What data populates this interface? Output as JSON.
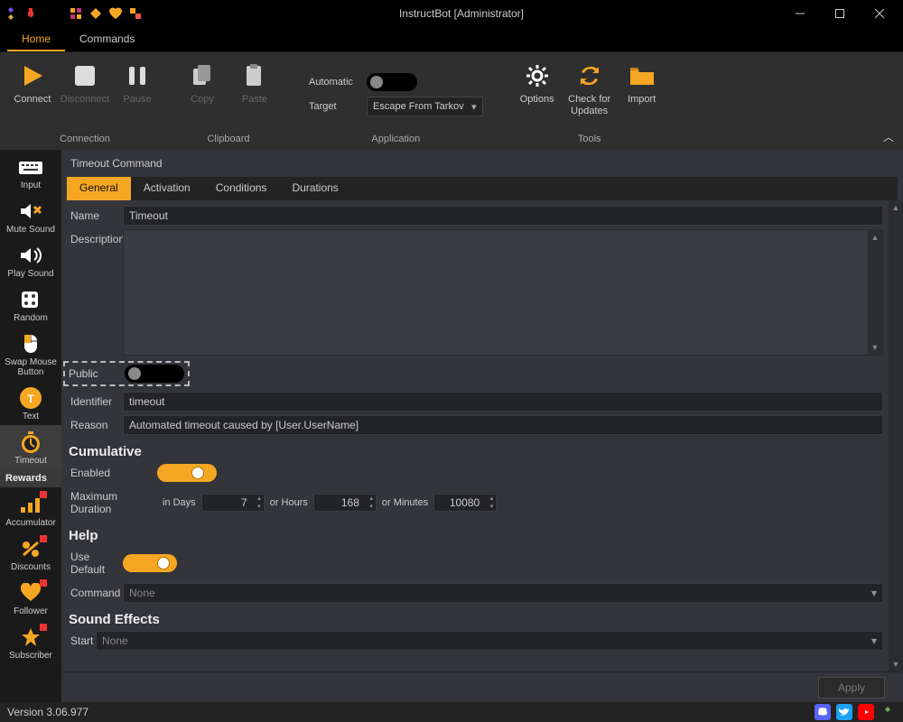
{
  "window": {
    "title": "InstructBot [Administrator]"
  },
  "menu": {
    "home": "Home",
    "commands": "Commands"
  },
  "ribbon": {
    "connection": {
      "label": "Connection",
      "connect": "Connect",
      "disconnect": "Disconnect",
      "pause": "Pause"
    },
    "clipboard": {
      "label": "Clipboard",
      "copy": "Copy",
      "paste": "Paste"
    },
    "application": {
      "label": "Application",
      "automatic": "Automatic",
      "target": "Target",
      "target_value": "Escape From Tarkov"
    },
    "tools": {
      "label": "Tools",
      "options": "Options",
      "updates": "Check for\nUpdates",
      "import": "Import"
    }
  },
  "sidebar": {
    "rewards_header": "Rewards",
    "items": [
      {
        "label": "Input"
      },
      {
        "label": "Mute Sound"
      },
      {
        "label": "Play Sound"
      },
      {
        "label": "Random"
      },
      {
        "label": "Swap Mouse\nButton"
      },
      {
        "label": "Text"
      },
      {
        "label": "Timeout"
      },
      {
        "label": "Accumulator"
      },
      {
        "label": "Discounts"
      },
      {
        "label": "Follower"
      },
      {
        "label": "Subscriber"
      }
    ]
  },
  "breadcrumb": "Timeout Command",
  "tabs": {
    "general": "General",
    "activation": "Activation",
    "conditions": "Conditions",
    "durations": "Durations"
  },
  "form": {
    "name_label": "Name",
    "name_value": "Timeout",
    "description_label": "Description",
    "public_label": "Public",
    "identifier_label": "Identifier",
    "identifier_value": "timeout",
    "reason_label": "Reason",
    "reason_value": "Automated timeout caused by [User.UserName]",
    "cumulative": {
      "heading": "Cumulative",
      "enabled_label": "Enabled",
      "maxdur_label": "Maximum Duration",
      "in_days": "in Days",
      "days_value": "7",
      "or_hours": "or Hours",
      "hours_value": "168",
      "or_minutes": "or Minutes",
      "minutes_value": "10080"
    },
    "help": {
      "heading": "Help",
      "use_default": "Use Default",
      "command_label": "Command",
      "command_value": "None"
    },
    "sound": {
      "heading": "Sound Effects",
      "start_label": "Start",
      "start_value": "None"
    }
  },
  "apply": "Apply",
  "status": {
    "version": "Version 3.06.977"
  }
}
